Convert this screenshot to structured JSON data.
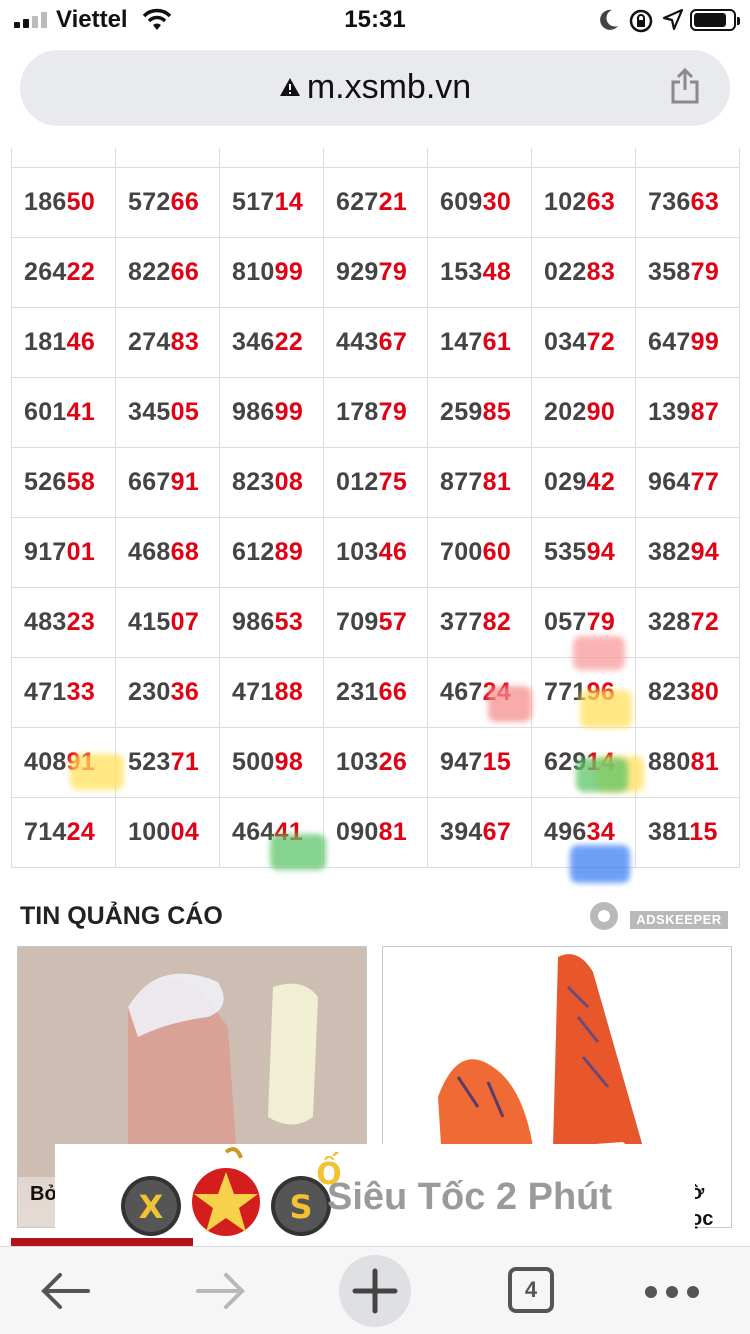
{
  "status_bar": {
    "carrier": "Viettel",
    "time": "15:31"
  },
  "browser": {
    "url": "m.xsmb.vn"
  },
  "results": {
    "rows": [
      [
        [
          "186",
          "50"
        ],
        [
          "572",
          "66"
        ],
        [
          "517",
          "14"
        ],
        [
          "627",
          "21"
        ],
        [
          "609",
          "30"
        ],
        [
          "102",
          "63"
        ],
        [
          "736",
          "63"
        ]
      ],
      [
        [
          "264",
          "22"
        ],
        [
          "822",
          "66"
        ],
        [
          "810",
          "99"
        ],
        [
          "929",
          "79"
        ],
        [
          "153",
          "48"
        ],
        [
          "022",
          "83"
        ],
        [
          "358",
          "79"
        ]
      ],
      [
        [
          "181",
          "46"
        ],
        [
          "274",
          "83"
        ],
        [
          "346",
          "22"
        ],
        [
          "443",
          "67"
        ],
        [
          "147",
          "61"
        ],
        [
          "034",
          "72"
        ],
        [
          "647",
          "99"
        ]
      ],
      [
        [
          "601",
          "41"
        ],
        [
          "345",
          "05"
        ],
        [
          "986",
          "99"
        ],
        [
          "178",
          "79"
        ],
        [
          "259",
          "85"
        ],
        [
          "202",
          "90"
        ],
        [
          "139",
          "87"
        ]
      ],
      [
        [
          "526",
          "58"
        ],
        [
          "667",
          "91"
        ],
        [
          "823",
          "08"
        ],
        [
          "012",
          "75"
        ],
        [
          "877",
          "81"
        ],
        [
          "029",
          "42"
        ],
        [
          "964",
          "77"
        ]
      ],
      [
        [
          "917",
          "01"
        ],
        [
          "468",
          "68"
        ],
        [
          "612",
          "89"
        ],
        [
          "103",
          "46"
        ],
        [
          "700",
          "60"
        ],
        [
          "535",
          "94"
        ],
        [
          "382",
          "94"
        ]
      ],
      [
        [
          "483",
          "23"
        ],
        [
          "415",
          "07"
        ],
        [
          "986",
          "53"
        ],
        [
          "709",
          "57"
        ],
        [
          "377",
          "82"
        ],
        [
          "057",
          "79"
        ],
        [
          "328",
          "72"
        ]
      ],
      [
        [
          "471",
          "33"
        ],
        [
          "230",
          "36"
        ],
        [
          "471",
          "88"
        ],
        [
          "231",
          "66"
        ],
        [
          "467",
          "24"
        ],
        [
          "771",
          "96"
        ],
        [
          "823",
          "80"
        ]
      ],
      [
        [
          "408",
          "91"
        ],
        [
          "523",
          "71"
        ],
        [
          "500",
          "98"
        ],
        [
          "103",
          "26"
        ],
        [
          "947",
          "15"
        ],
        [
          "629",
          "14"
        ],
        [
          "880",
          "81"
        ]
      ],
      [
        [
          "714",
          "24"
        ],
        [
          "100",
          "04"
        ],
        [
          "464",
          "41"
        ],
        [
          "090",
          "81"
        ],
        [
          "394",
          "67"
        ],
        [
          "496",
          "34"
        ],
        [
          "381",
          "15"
        ]
      ]
    ]
  },
  "ads": {
    "title": "TIN QUẢNG CÁO",
    "provider": "ADSKEEPER",
    "card1_caption": "Bỏ",
    "card2_caption_line1": "ờ",
    "card2_caption_line2": "ọc"
  },
  "banner": {
    "tagline": "Siêu Tốc 2 Phút",
    "logo_letters": [
      "X",
      "S",
      "Ố"
    ]
  },
  "toolbar": {
    "tab_count": "4"
  },
  "colors": {
    "accent_red": "#e30012",
    "url_bar_bg": "#e9eaee"
  }
}
